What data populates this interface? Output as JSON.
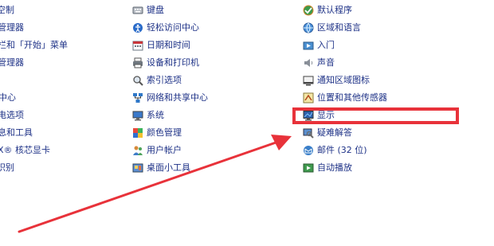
{
  "column1": [
    {
      "label": "空制",
      "icon": "control-icon"
    },
    {
      "label": "管理器",
      "icon": "manager-icon"
    },
    {
      "label": "栏和「开始」菜单",
      "icon": "taskbar-icon"
    },
    {
      "label": "管理器",
      "icon": "manager-icon"
    },
    {
      "label": "中心",
      "icon": "center-icon"
    },
    {
      "label": "电选项",
      "icon": "power-icon"
    },
    {
      "label": "息和工具",
      "icon": "info-icon"
    },
    {
      "label": "X® 核芯显卡",
      "icon": "graphics-icon"
    },
    {
      "label": "识别",
      "icon": "recognition-icon"
    }
  ],
  "column2": [
    {
      "label": "键盘",
      "icon": "keyboard-icon"
    },
    {
      "label": "轻松访问中心",
      "icon": "ease-of-access-icon"
    },
    {
      "label": "日期和时间",
      "icon": "calendar-icon"
    },
    {
      "label": "设备和打印机",
      "icon": "printer-icon"
    },
    {
      "label": "索引选项",
      "icon": "search-index-icon"
    },
    {
      "label": "网络和共享中心",
      "icon": "network-icon"
    },
    {
      "label": "系统",
      "icon": "system-icon"
    },
    {
      "label": "颜色管理",
      "icon": "color-icon"
    },
    {
      "label": "用户帐户",
      "icon": "users-icon"
    },
    {
      "label": "桌面小工具",
      "icon": "gadgets-icon"
    }
  ],
  "column3": [
    {
      "label": "默认程序",
      "icon": "default-programs-icon"
    },
    {
      "label": "区域和语言",
      "icon": "globe-icon"
    },
    {
      "label": "入门",
      "icon": "getting-started-icon"
    },
    {
      "label": "声音",
      "icon": "speaker-icon"
    },
    {
      "label": "通知区域图标",
      "icon": "notification-icon"
    },
    {
      "label": "位置和其他传感器",
      "icon": "sensor-icon"
    },
    {
      "label": "显示",
      "icon": "display-icon"
    },
    {
      "label": "疑难解答",
      "icon": "troubleshoot-icon"
    },
    {
      "label": "邮件 (32 位)",
      "icon": "mail-icon"
    },
    {
      "label": "自动播放",
      "icon": "autoplay-icon"
    }
  ],
  "annotation": {
    "highlight_color": "#e8323a",
    "arrow_color": "#e8323a"
  },
  "colors": {
    "link": "#1e3287"
  }
}
